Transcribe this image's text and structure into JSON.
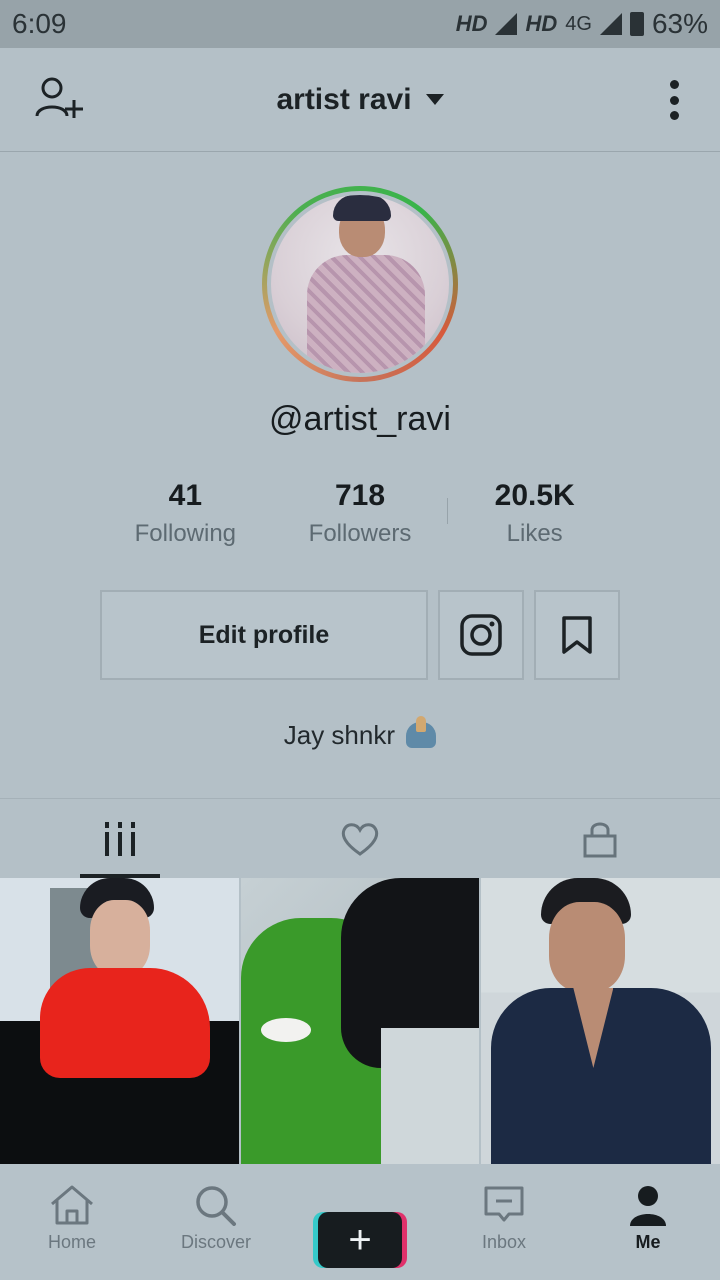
{
  "status_bar": {
    "time": "6:09",
    "network1": "HD",
    "network2": "HD",
    "net_type": "4G",
    "battery_pct": "63%"
  },
  "header": {
    "title": "artist ravi"
  },
  "profile": {
    "handle": "@artist_ravi",
    "stats": [
      {
        "value": "41",
        "label": "Following"
      },
      {
        "value": "718",
        "label": "Followers"
      },
      {
        "value": "20.5K",
        "label": "Likes"
      }
    ],
    "edit_label": "Edit profile",
    "bio": "Jay shnkr"
  },
  "tabs": [
    {
      "icon": "videos-grid-icon",
      "active": true
    },
    {
      "icon": "heart-icon",
      "active": false
    },
    {
      "icon": "lock-icon",
      "active": false
    }
  ],
  "nav": {
    "home": "Home",
    "discover": "Discover",
    "inbox": "Inbox",
    "me": "Me"
  },
  "colors": {
    "background": "#b4c0c7",
    "text_primary": "#171c1f",
    "create_left": "#36c9c9",
    "create_right": "#e0306a"
  }
}
